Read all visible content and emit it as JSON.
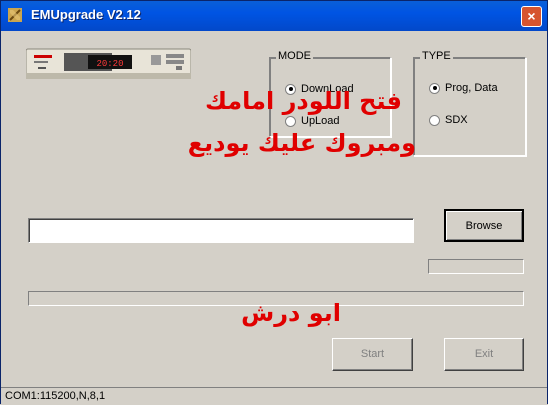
{
  "window": {
    "title": "EMUpgrade V2.12",
    "close_label": "×"
  },
  "mode": {
    "label": "MODE",
    "options": [
      {
        "label": "DownLoad",
        "selected": true
      },
      {
        "label": "UpLoad",
        "selected": false
      }
    ]
  },
  "type": {
    "label": "TYPE",
    "options": [
      {
        "label": "Prog, Data",
        "selected": true
      },
      {
        "label": "SDX",
        "selected": false
      }
    ]
  },
  "overlay": {
    "line1": "فتح اللودر امامك",
    "line2": "ومبروك عليك يوديع",
    "signature": "ابو درش",
    "color": "#e00000"
  },
  "device_display": "20:20",
  "file_path": "",
  "buttons": {
    "browse": "Browse",
    "start": "Start",
    "exit": "Exit"
  },
  "status": {
    "port": "COM1:115200,N,8,1"
  }
}
